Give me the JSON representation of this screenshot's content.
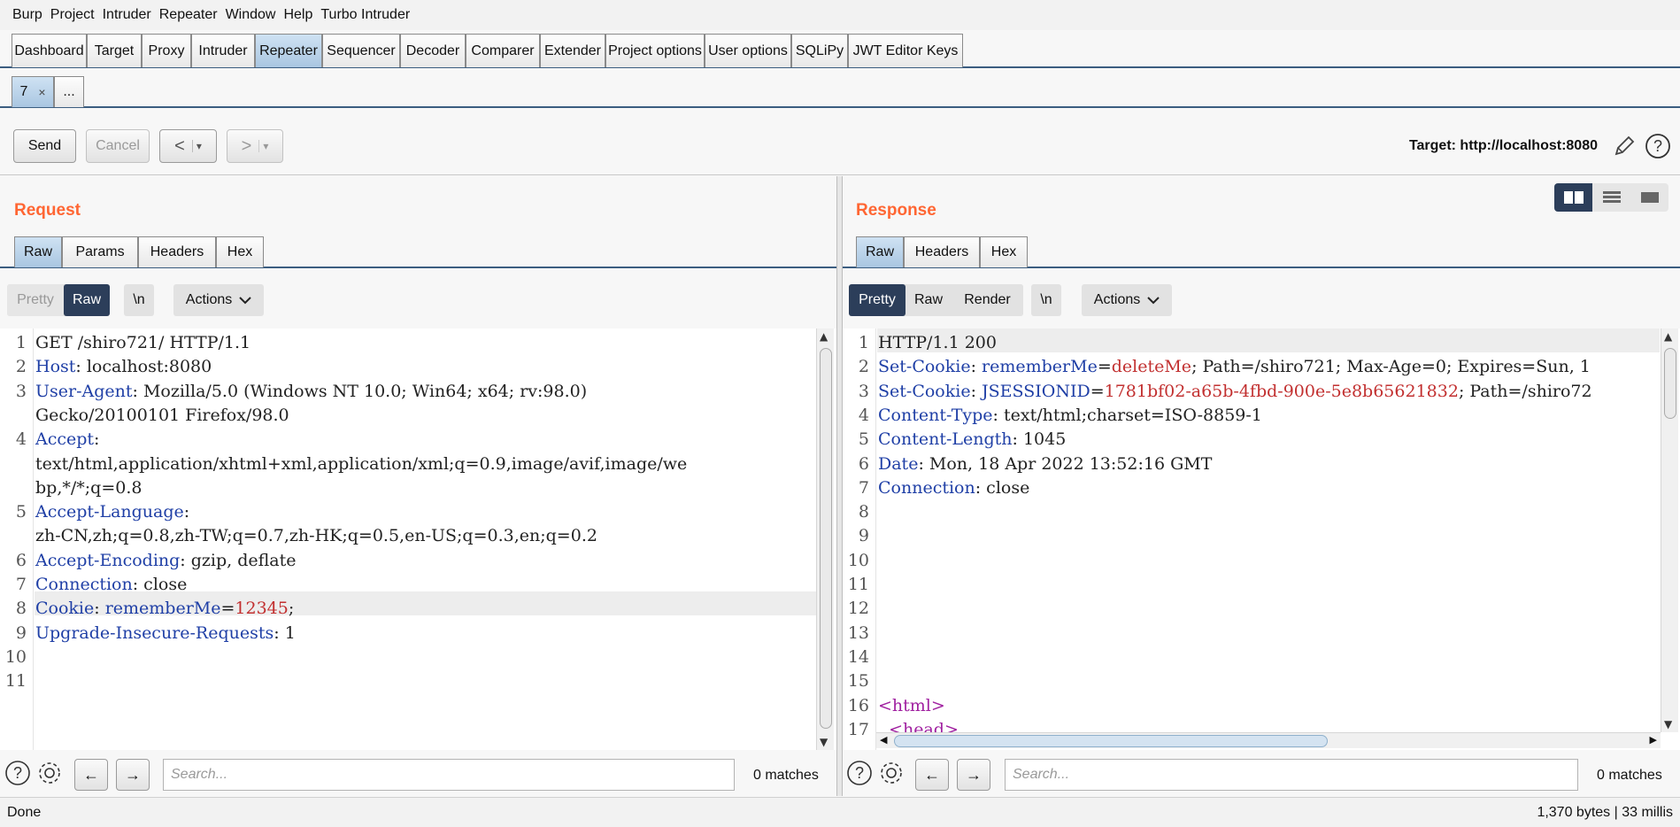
{
  "menu": [
    "Burp",
    "Project",
    "Intruder",
    "Repeater",
    "Window",
    "Help",
    "Turbo Intruder"
  ],
  "main_tabs": [
    "Dashboard",
    "Target",
    "Proxy",
    "Intruder",
    "Repeater",
    "Sequencer",
    "Decoder",
    "Comparer",
    "Extender",
    "Project options",
    "User options",
    "SQLiPy",
    "JWT Editor Keys"
  ],
  "active_main_tab": "Repeater",
  "repeater_tabs": [
    {
      "label": "7",
      "close": "×"
    },
    {
      "label": "..."
    }
  ],
  "toolbar": {
    "send": "Send",
    "cancel": "Cancel",
    "back": "<",
    "forward": ">",
    "dropdown": "▾",
    "target": "Target: http://localhost:8080"
  },
  "request": {
    "title": "Request",
    "tabs": [
      "Raw",
      "Params",
      "Headers",
      "Hex"
    ],
    "view": {
      "pretty": "Pretty",
      "raw": "Raw",
      "newline": "\\n",
      "actions": "Actions"
    },
    "line_numbers": [
      "1",
      "2",
      "3",
      "",
      "4",
      "",
      "",
      "5",
      "",
      "6",
      "7",
      "8",
      "9",
      "10",
      "11"
    ],
    "lines": [
      {
        "parts": [
          {
            "t": "GET /shiro721/ HTTP/1.1",
            "c": ""
          }
        ]
      },
      {
        "parts": [
          {
            "t": "Host",
            "c": "k"
          },
          {
            "t": ": localhost:8080",
            "c": ""
          }
        ]
      },
      {
        "parts": [
          {
            "t": "User-Agent",
            "c": "k"
          },
          {
            "t": ": Mozilla/5.0 (Windows NT 10.0; Win64; x64; rv:98.0)",
            "c": ""
          }
        ]
      },
      {
        "parts": [
          {
            "t": "Gecko/20100101 Firefox/98.0",
            "c": ""
          }
        ]
      },
      {
        "parts": [
          {
            "t": "Accept",
            "c": "k"
          },
          {
            "t": ":",
            "c": ""
          }
        ]
      },
      {
        "parts": [
          {
            "t": "text/html,application/xhtml+xml,application/xml;q=0.9,image/avif,image/we",
            "c": ""
          }
        ]
      },
      {
        "parts": [
          {
            "t": "bp,*/*;q=0.8",
            "c": ""
          }
        ]
      },
      {
        "parts": [
          {
            "t": "Accept-Language",
            "c": "k"
          },
          {
            "t": ":",
            "c": ""
          }
        ]
      },
      {
        "parts": [
          {
            "t": "zh-CN,zh;q=0.8,zh-TW;q=0.7,zh-HK;q=0.5,en-US;q=0.3,en;q=0.2",
            "c": ""
          }
        ]
      },
      {
        "parts": [
          {
            "t": "Accept-Encoding",
            "c": "k"
          },
          {
            "t": ": gzip, deflate",
            "c": ""
          }
        ]
      },
      {
        "parts": [
          {
            "t": "Connection",
            "c": "k"
          },
          {
            "t": ": close",
            "c": ""
          }
        ]
      },
      {
        "parts": [
          {
            "t": "Cookie",
            "c": "k"
          },
          {
            "t": ": ",
            "c": ""
          },
          {
            "t": "rememberMe",
            "c": "k"
          },
          {
            "t": "=",
            "c": ""
          },
          {
            "t": "12345",
            "c": "v"
          },
          {
            "t": ";",
            "c": ""
          }
        ]
      },
      {
        "parts": [
          {
            "t": "Upgrade-Insecure-Requests",
            "c": "k"
          },
          {
            "t": ": 1",
            "c": ""
          }
        ]
      },
      {
        "parts": [
          {
            "t": "",
            "c": ""
          }
        ]
      },
      {
        "parts": [
          {
            "t": "",
            "c": ""
          }
        ]
      }
    ],
    "search_placeholder": "Search...",
    "matches": "0 matches"
  },
  "response": {
    "title": "Response",
    "tabs": [
      "Raw",
      "Headers",
      "Hex"
    ],
    "view": {
      "pretty": "Pretty",
      "raw": "Raw",
      "render": "Render",
      "newline": "\\n",
      "actions": "Actions"
    },
    "line_numbers": [
      "1",
      "2",
      "3",
      "4",
      "5",
      "6",
      "7",
      "8",
      "9",
      "10",
      "11",
      "12",
      "13",
      "14",
      "15",
      "16",
      "17"
    ],
    "lines": [
      {
        "parts": [
          {
            "t": "HTTP/1.1 200",
            "c": ""
          }
        ]
      },
      {
        "parts": [
          {
            "t": "Set-Cookie",
            "c": "k"
          },
          {
            "t": ": ",
            "c": ""
          },
          {
            "t": "rememberMe",
            "c": "k"
          },
          {
            "t": "=",
            "c": ""
          },
          {
            "t": "deleteMe",
            "c": "v"
          },
          {
            "t": "; Path=/shiro721; Max-Age=0; Expires=Sun, 1",
            "c": ""
          }
        ]
      },
      {
        "parts": [
          {
            "t": "Set-Cookie",
            "c": "k"
          },
          {
            "t": ": ",
            "c": ""
          },
          {
            "t": "JSESSIONID",
            "c": "k"
          },
          {
            "t": "=",
            "c": ""
          },
          {
            "t": "1781bf02-a65b-4fbd-900e-5e8b65621832",
            "c": "v"
          },
          {
            "t": "; Path=/shiro72",
            "c": ""
          }
        ]
      },
      {
        "parts": [
          {
            "t": "Content-Type",
            "c": "k"
          },
          {
            "t": ": text/html;charset=ISO-8859-1",
            "c": ""
          }
        ]
      },
      {
        "parts": [
          {
            "t": "Content-Length",
            "c": "k"
          },
          {
            "t": ": 1045",
            "c": ""
          }
        ]
      },
      {
        "parts": [
          {
            "t": "Date",
            "c": "k"
          },
          {
            "t": ": Mon, 18 Apr 2022 13:52:16 GMT",
            "c": ""
          }
        ]
      },
      {
        "parts": [
          {
            "t": "Connection",
            "c": "k"
          },
          {
            "t": ": close",
            "c": ""
          }
        ]
      },
      {
        "parts": [
          {
            "t": "",
            "c": ""
          }
        ]
      },
      {
        "parts": [
          {
            "t": "",
            "c": ""
          }
        ]
      },
      {
        "parts": [
          {
            "t": "",
            "c": ""
          }
        ]
      },
      {
        "parts": [
          {
            "t": "",
            "c": ""
          }
        ]
      },
      {
        "parts": [
          {
            "t": "",
            "c": ""
          }
        ]
      },
      {
        "parts": [
          {
            "t": "",
            "c": ""
          }
        ]
      },
      {
        "parts": [
          {
            "t": "",
            "c": ""
          }
        ]
      },
      {
        "parts": [
          {
            "t": "",
            "c": ""
          }
        ]
      },
      {
        "parts": [
          {
            "t": "<html>",
            "c": "tag"
          }
        ]
      },
      {
        "parts": [
          {
            "t": "  <head>",
            "c": "tag"
          }
        ]
      }
    ],
    "search_placeholder": "Search...",
    "matches": "0 matches"
  },
  "status": {
    "left": "Done",
    "right": "1,370 bytes | 33 millis"
  },
  "colors": {
    "accent_orange": "#ff6633",
    "tab_active": "#a9c6e1",
    "dark_button": "#2c3e5a",
    "key": "#1f3fa6",
    "value": "#c23030",
    "tag": "#a020a0"
  }
}
